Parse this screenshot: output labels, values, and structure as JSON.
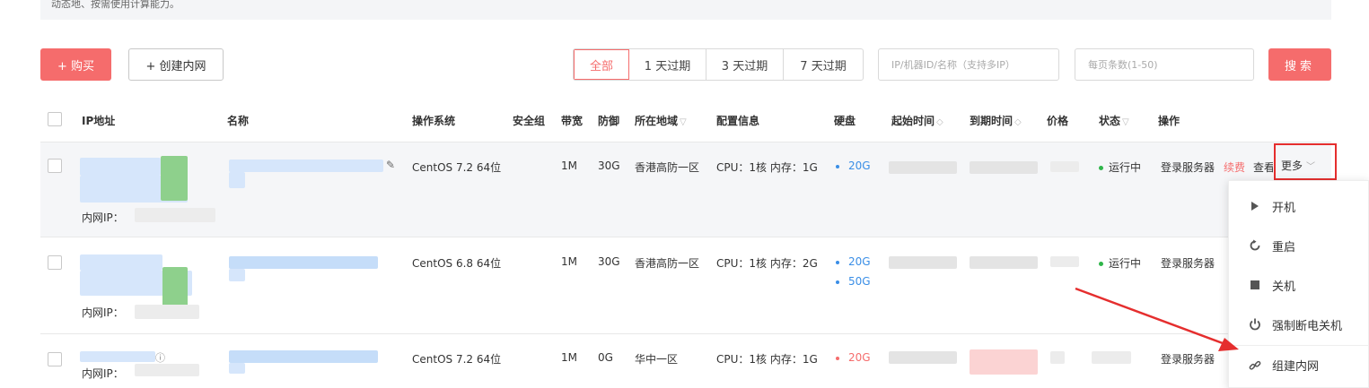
{
  "notice": "动态地、按需使用计算能力。",
  "toolbar": {
    "buy_label": "+ 购买",
    "create_lan_label": "+ 创建内网",
    "filters": [
      "全部",
      "1 天过期",
      "3 天过期",
      "7 天过期"
    ],
    "ip_placeholder": "IP/机器ID/名称（支持多IP）",
    "per_page_placeholder": "每页条数(1-50)",
    "search_label": "搜索"
  },
  "columns": [
    "IP地址",
    "名称",
    "操作系统",
    "安全组",
    "带宽",
    "防御",
    "所在地域",
    "配置信息",
    "硬盘",
    "起始时间",
    "到期时间",
    "价格",
    "状态",
    "操作"
  ],
  "rows": [
    {
      "lan_ip_label": "内网IP：",
      "os": "CentOS 7.2 64位",
      "bandwidth": "1M",
      "defense": "30G",
      "region": "香港高防一区",
      "config": "CPU：1核 内存：1G",
      "disks": [
        "20G"
      ],
      "status": "运行中",
      "ops": [
        "登录服务器",
        "续费",
        "查看"
      ]
    },
    {
      "lan_ip_label": "内网IP：",
      "os": "CentOS 6.8 64位",
      "bandwidth": "1M",
      "defense": "30G",
      "region": "香港高防一区",
      "config": "CPU：1核 内存：2G",
      "disks": [
        "20G",
        "50G"
      ],
      "status": "运行中",
      "ops": [
        "登录服务器"
      ]
    },
    {
      "lan_ip_label": "内网IP：",
      "os": "CentOS 7.2 64位",
      "bandwidth": "1M",
      "defense": "0G",
      "region": "华中一区",
      "config": "CPU：1核 内存：1G",
      "disks": [
        "20G"
      ],
      "status": "",
      "ops": [
        "登录服务器"
      ]
    }
  ],
  "more_label": "更多",
  "dropdown": {
    "items": [
      "开机",
      "重启",
      "关机",
      "强制断电关机",
      "组建内网"
    ]
  },
  "colors": {
    "accent": "#f56c6c",
    "link": "#3a8ee6",
    "running": "#2fb54a",
    "highlight": "#e52e2e"
  }
}
